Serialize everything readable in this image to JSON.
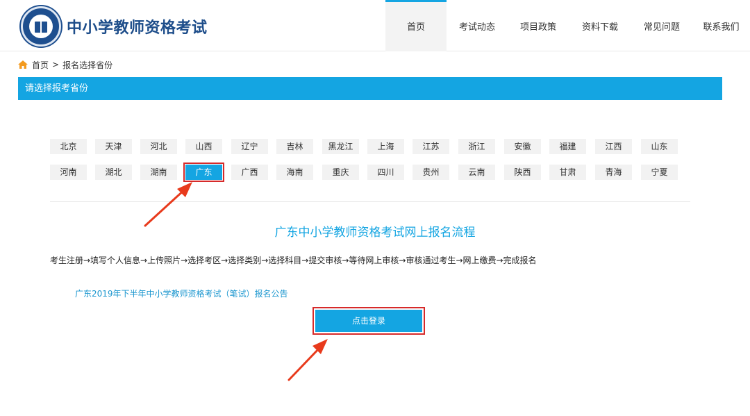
{
  "header": {
    "site_title": "中小学教师资格考试",
    "nav": [
      {
        "label": "首页",
        "active": true
      },
      {
        "label": "考试动态",
        "active": false
      },
      {
        "label": "项目政策",
        "active": false
      },
      {
        "label": "资料下载",
        "active": false
      },
      {
        "label": "常见问题",
        "active": false
      },
      {
        "label": "联系我们",
        "active": false
      }
    ]
  },
  "breadcrumb": {
    "home": "首页",
    "separator": ">",
    "current": "报名选择省份"
  },
  "section_bar": {
    "title": "请选择报考省份"
  },
  "provinces": {
    "row1": [
      "北京",
      "天津",
      "河北",
      "山西",
      "辽宁",
      "吉林",
      "黑龙江",
      "上海",
      "江苏",
      "浙江",
      "安徽",
      "福建",
      "江西",
      "山东"
    ],
    "row2": [
      "河南",
      "湖北",
      "湖南",
      "广东",
      "广西",
      "海南",
      "重庆",
      "四川",
      "贵州",
      "云南",
      "陕西",
      "甘肃",
      "青海",
      "宁夏"
    ],
    "selected": "广东"
  },
  "flow": {
    "title": "广东中小学教师资格考试网上报名流程",
    "steps": "考生注册→填写个人信息→上传照片→选择考区→选择类别→选择科目→提交审核→等待网上审核→审核通过考生→网上缴费→完成报名"
  },
  "notice": {
    "link_text": "广东2019年下半年中小学教师资格考试（笔试）报名公告"
  },
  "login": {
    "label": "点击登录"
  },
  "colors": {
    "accent": "#14a5e2",
    "brand": "#1d4d8a",
    "highlight": "#d62a2a"
  }
}
